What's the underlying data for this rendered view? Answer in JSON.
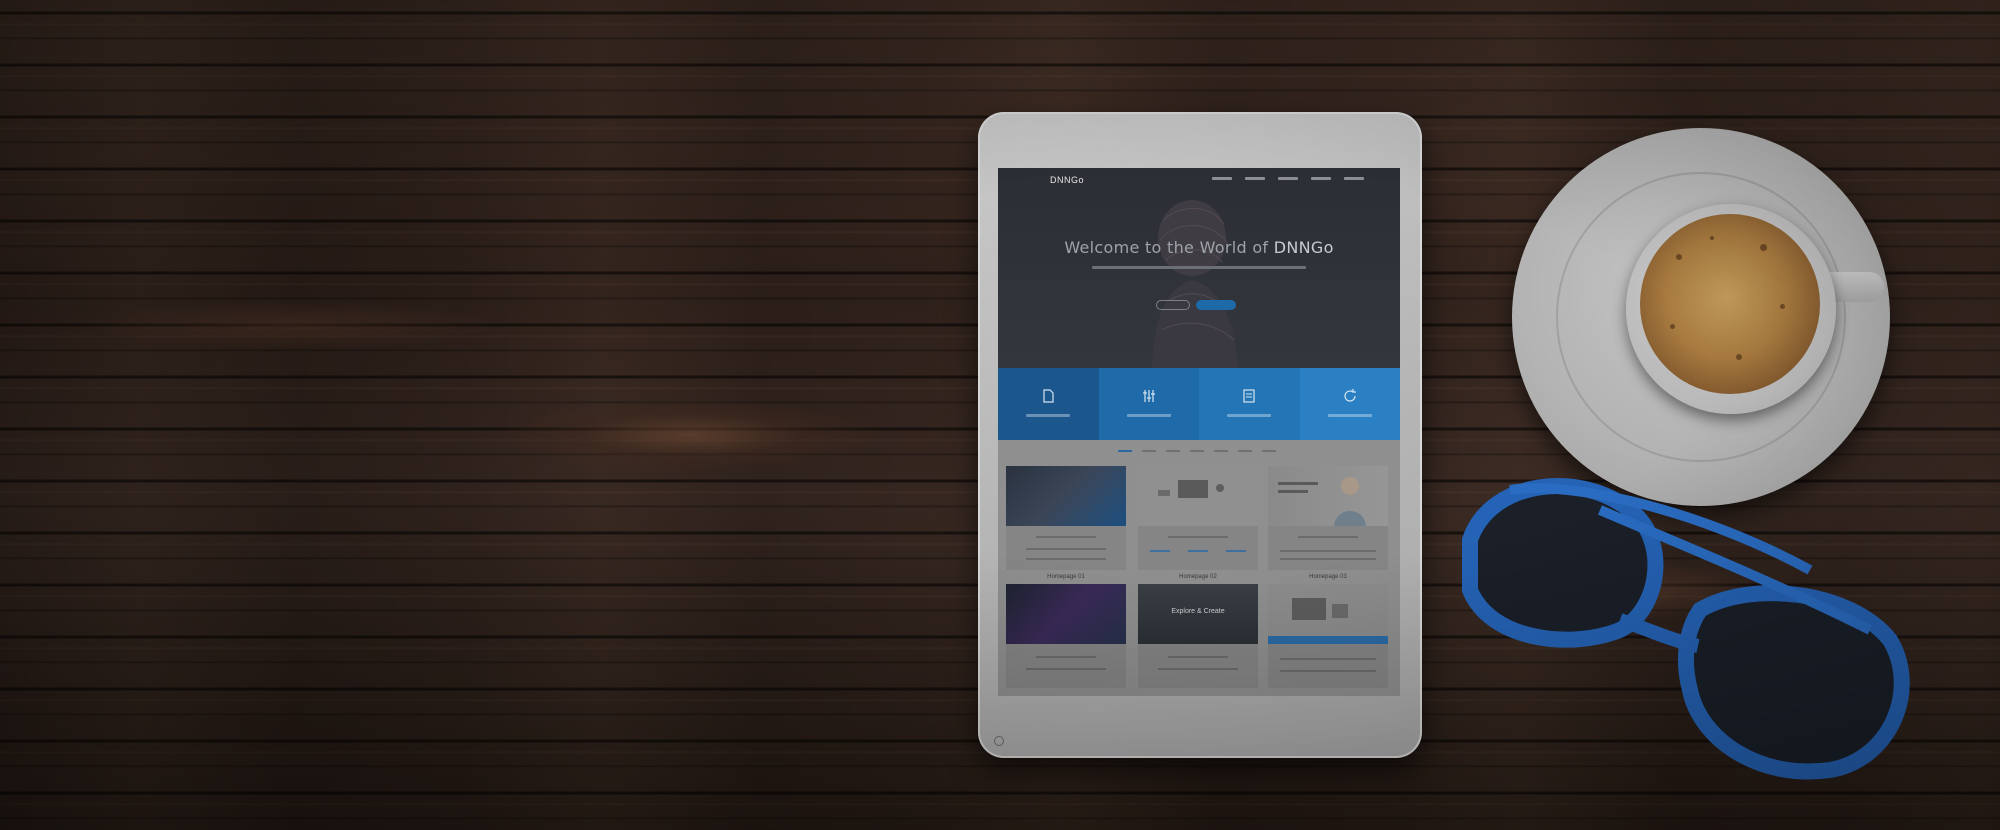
{
  "scene": {
    "description_colors": {
      "wood": "#3b2a22",
      "accent_blue": "#2a80c2",
      "glasses_blue": "#2563b6"
    }
  },
  "tablet": {
    "site": {
      "logo": "DNNGo",
      "hero_title_prefix": "Welcome to the World of ",
      "hero_title_brand": "DNNGo"
    },
    "demos": {
      "captions": [
        "Homepage 01",
        "Homepage 02",
        "Homepage 03"
      ],
      "card5_heading": "Explore & Create"
    }
  }
}
